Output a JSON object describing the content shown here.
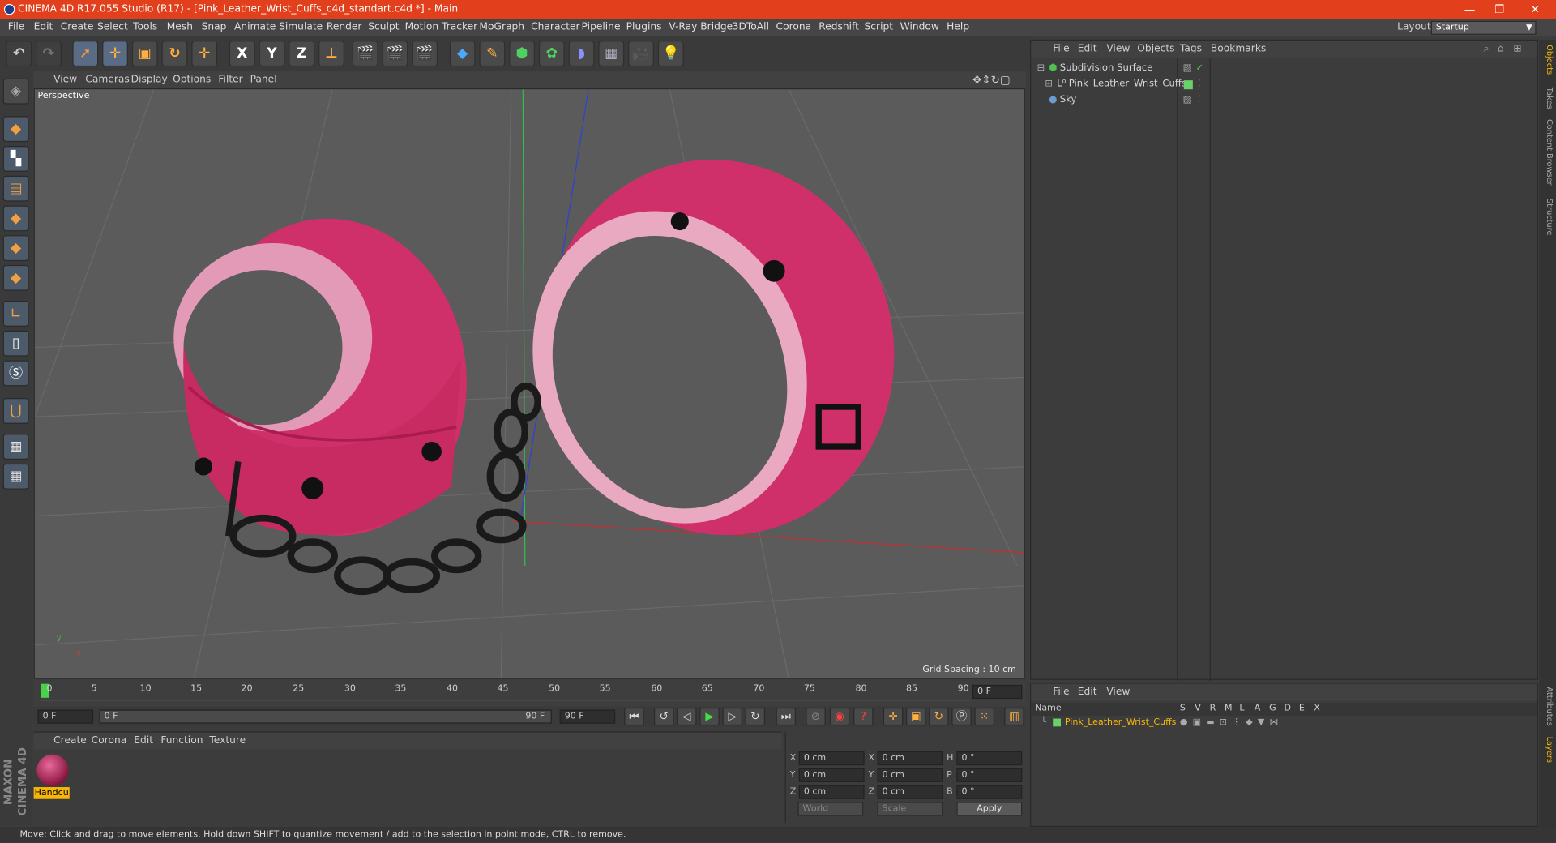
{
  "window": {
    "title": "CINEMA 4D R17.055 Studio (R17) - [Pink_Leather_Wrist_Cuffs_c4d_standart.c4d *] - Main",
    "minimize": "—",
    "maximize": "❐",
    "close": "✕"
  },
  "menu": {
    "items": [
      "File",
      "Edit",
      "Create",
      "Select",
      "Tools",
      "Mesh",
      "Snap",
      "Animate",
      "Simulate",
      "Render",
      "Sculpt",
      "Motion Tracker",
      "MoGraph",
      "Character",
      "Pipeline",
      "Plugins",
      "V-Ray Bridge",
      "3DToAll",
      "Corona",
      "Redshift",
      "Script",
      "Window",
      "Help"
    ],
    "layout_label": "Layout:",
    "layout_value": "Startup"
  },
  "toolbar": {
    "axis_x": "X",
    "axis_y": "Y",
    "axis_z": "Z"
  },
  "viewport": {
    "menu": [
      "View",
      "Cameras",
      "Display",
      "Options",
      "Filter",
      "Panel"
    ],
    "camera_label": "Perspective",
    "grid_spacing": "Grid Spacing : 10 cm",
    "axis_y": "y",
    "axis_x": "x"
  },
  "timeline": {
    "ticks": [
      "0",
      "5",
      "10",
      "15",
      "20",
      "25",
      "30",
      "35",
      "40",
      "45",
      "50",
      "55",
      "60",
      "65",
      "70",
      "75",
      "80",
      "85",
      "90"
    ],
    "current_frame": "0 F",
    "start_field": "0 F",
    "range_start": "0 F",
    "range_end": "90 F",
    "end_field": "90 F"
  },
  "material_manager": {
    "menu": [
      "Create",
      "Corona",
      "Edit",
      "Function",
      "Texture"
    ],
    "material_name": "Handcu"
  },
  "coordinates": {
    "headers": [
      "--",
      "--",
      "--"
    ],
    "rows": [
      {
        "a": "X",
        "av": "0 cm",
        "b": "X",
        "bv": "0 cm",
        "c": "H",
        "cv": "0 °"
      },
      {
        "a": "Y",
        "av": "0 cm",
        "b": "Y",
        "bv": "0 cm",
        "c": "P",
        "cv": "0 °"
      },
      {
        "a": "Z",
        "av": "0 cm",
        "b": "Z",
        "bv": "0 cm",
        "c": "B",
        "cv": "0 °"
      }
    ],
    "mode_select": "World",
    "scale_select": "Scale",
    "apply": "Apply"
  },
  "object_manager": {
    "menu": [
      "File",
      "Edit",
      "View",
      "Objects",
      "Tags",
      "Bookmarks"
    ],
    "objects": [
      {
        "name": "Subdivision Surface",
        "color": "#4fc24f"
      },
      {
        "name": "Pink_Leather_Wrist_Cuffs",
        "color": "#6ad06a"
      },
      {
        "name": "Sky",
        "color": "#6a9ad0"
      }
    ]
  },
  "layer_manager": {
    "menu": [
      "File",
      "Edit",
      "View"
    ],
    "col_name": "Name",
    "cols": [
      "S",
      "V",
      "R",
      "M",
      "L",
      "A",
      "G",
      "D",
      "E",
      "X"
    ],
    "layer_name": "Pink_Leather_Wrist_Cuffs",
    "layer_color": "#f6b60a"
  },
  "right_tabs": [
    "Objects",
    "Takes",
    "Content Browser",
    "Structure",
    "Attributes",
    "Layers"
  ],
  "status": "Move: Click and drag to move elements. Hold down SHIFT to quantize movement / add to the selection in point mode, CTRL to remove.",
  "logo": "MAXON CINEMA 4D",
  "accent": "#e2401c"
}
